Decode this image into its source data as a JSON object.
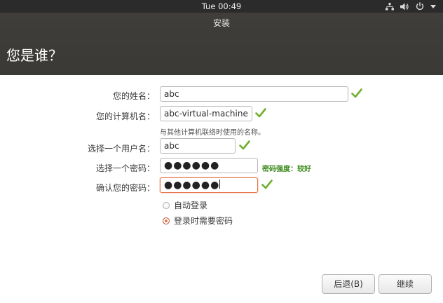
{
  "topbar": {
    "clock": "Tue 00:49"
  },
  "window": {
    "title": "安装"
  },
  "page": {
    "title": "您是谁？"
  },
  "form": {
    "name": {
      "label": "您的姓名：",
      "value": "abc"
    },
    "computer": {
      "label": "您的计算机名：",
      "value": "abc-virtual-machine",
      "hint": "与其他计算机联络时使用的名称。"
    },
    "username": {
      "label": "选择一个用户名：",
      "value": "abc"
    },
    "password": {
      "label": "选择一个密码：",
      "masked": "●●●●●●",
      "strength": "密码强度：较好"
    },
    "confirm": {
      "label": "确认您的密码：",
      "masked": "●●●●●●"
    },
    "login_options": [
      {
        "label": "自动登录",
        "selected": false
      },
      {
        "label": "登录时需要密码",
        "selected": true
      }
    ]
  },
  "buttons": {
    "back": "后退(B)",
    "continue": "继续"
  },
  "colors": {
    "accent": "#e9734a",
    "check": "#6fae2f",
    "strength": "#3b8a1c",
    "header": "#3d3b37"
  }
}
